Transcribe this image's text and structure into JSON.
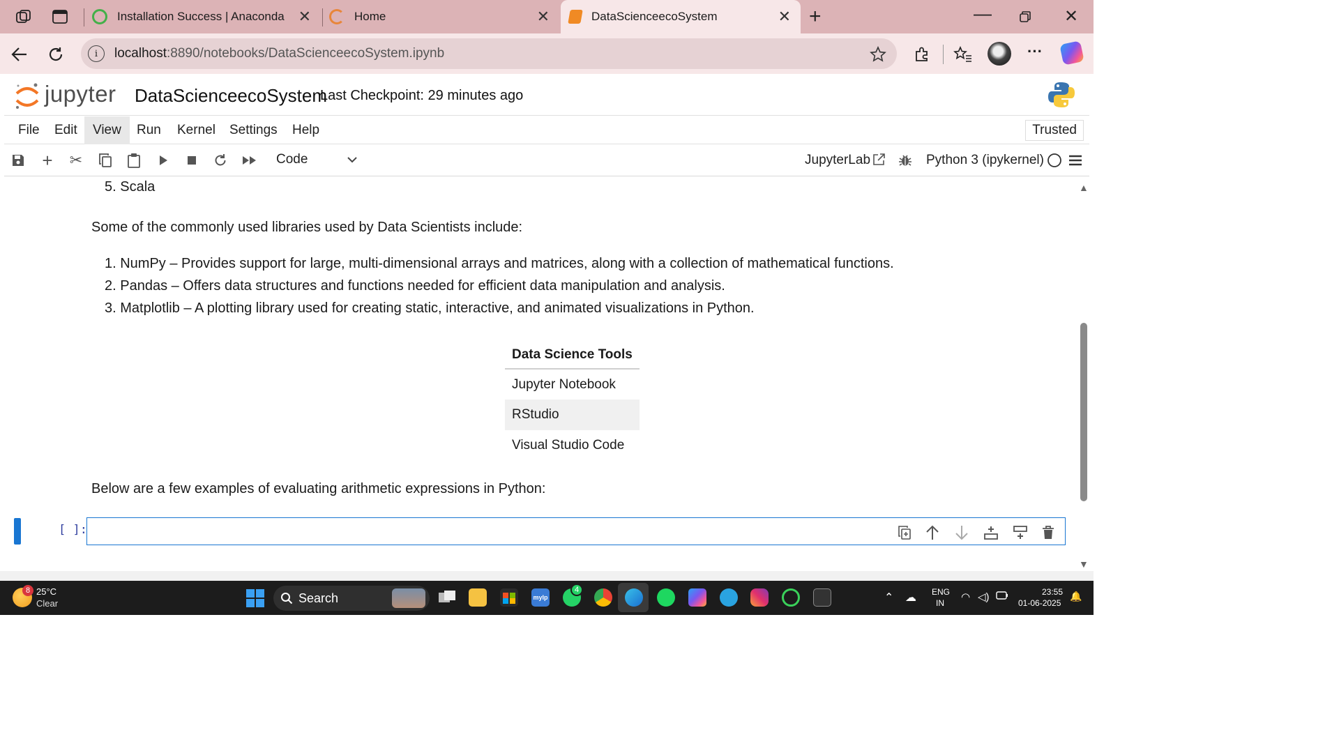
{
  "browser": {
    "tabs": [
      {
        "title": "Installation Success | Anaconda"
      },
      {
        "title": "Home"
      },
      {
        "title": "DataScienceecoSystem"
      }
    ],
    "url_host": "localhost",
    "url_path": ":8890/notebooks/DataScienceecoSystem.ipynb"
  },
  "jupyter": {
    "logo_text": "jupyter",
    "notebook_title": "DataScienceecoSystem",
    "checkpoint": "Last Checkpoint: 29 minutes ago",
    "menus": [
      "File",
      "Edit",
      "View",
      "Run",
      "Kernel",
      "Settings",
      "Help"
    ],
    "trusted": "Trusted",
    "cell_type": "Code",
    "jupyterlab_link": "JupyterLab",
    "kernel": "Python 3 (ipykernel)"
  },
  "notebook": {
    "list_item_5": "5. Scala",
    "libraries_intro": "Some of the commonly used libraries used by Data Scientists include:",
    "libraries": [
      "1. NumPy – Provides support for large, multi-dimensional arrays and matrices, along with a collection of mathematical functions.",
      "2. Pandas – Offers data structures and functions needed for efficient data manipulation and analysis.",
      "3. Matplotlib – A plotting library used for creating static, interactive, and animated visualizations in Python."
    ],
    "table_header": "Data Science Tools",
    "table_rows": [
      "Jupyter Notebook",
      "RStudio",
      "Visual Studio Code"
    ],
    "arith_intro": "Below are a few examples of evaluating arithmetic expressions in Python:",
    "cell_prompt": "[ ]:"
  },
  "taskbar": {
    "weather_badge": "8",
    "temperature": "25°C",
    "condition": "Clear",
    "search": "Search",
    "whatsapp_badge": "4",
    "language": "ENG",
    "region": "IN",
    "time": "23:55",
    "date": "01-06-2025"
  }
}
